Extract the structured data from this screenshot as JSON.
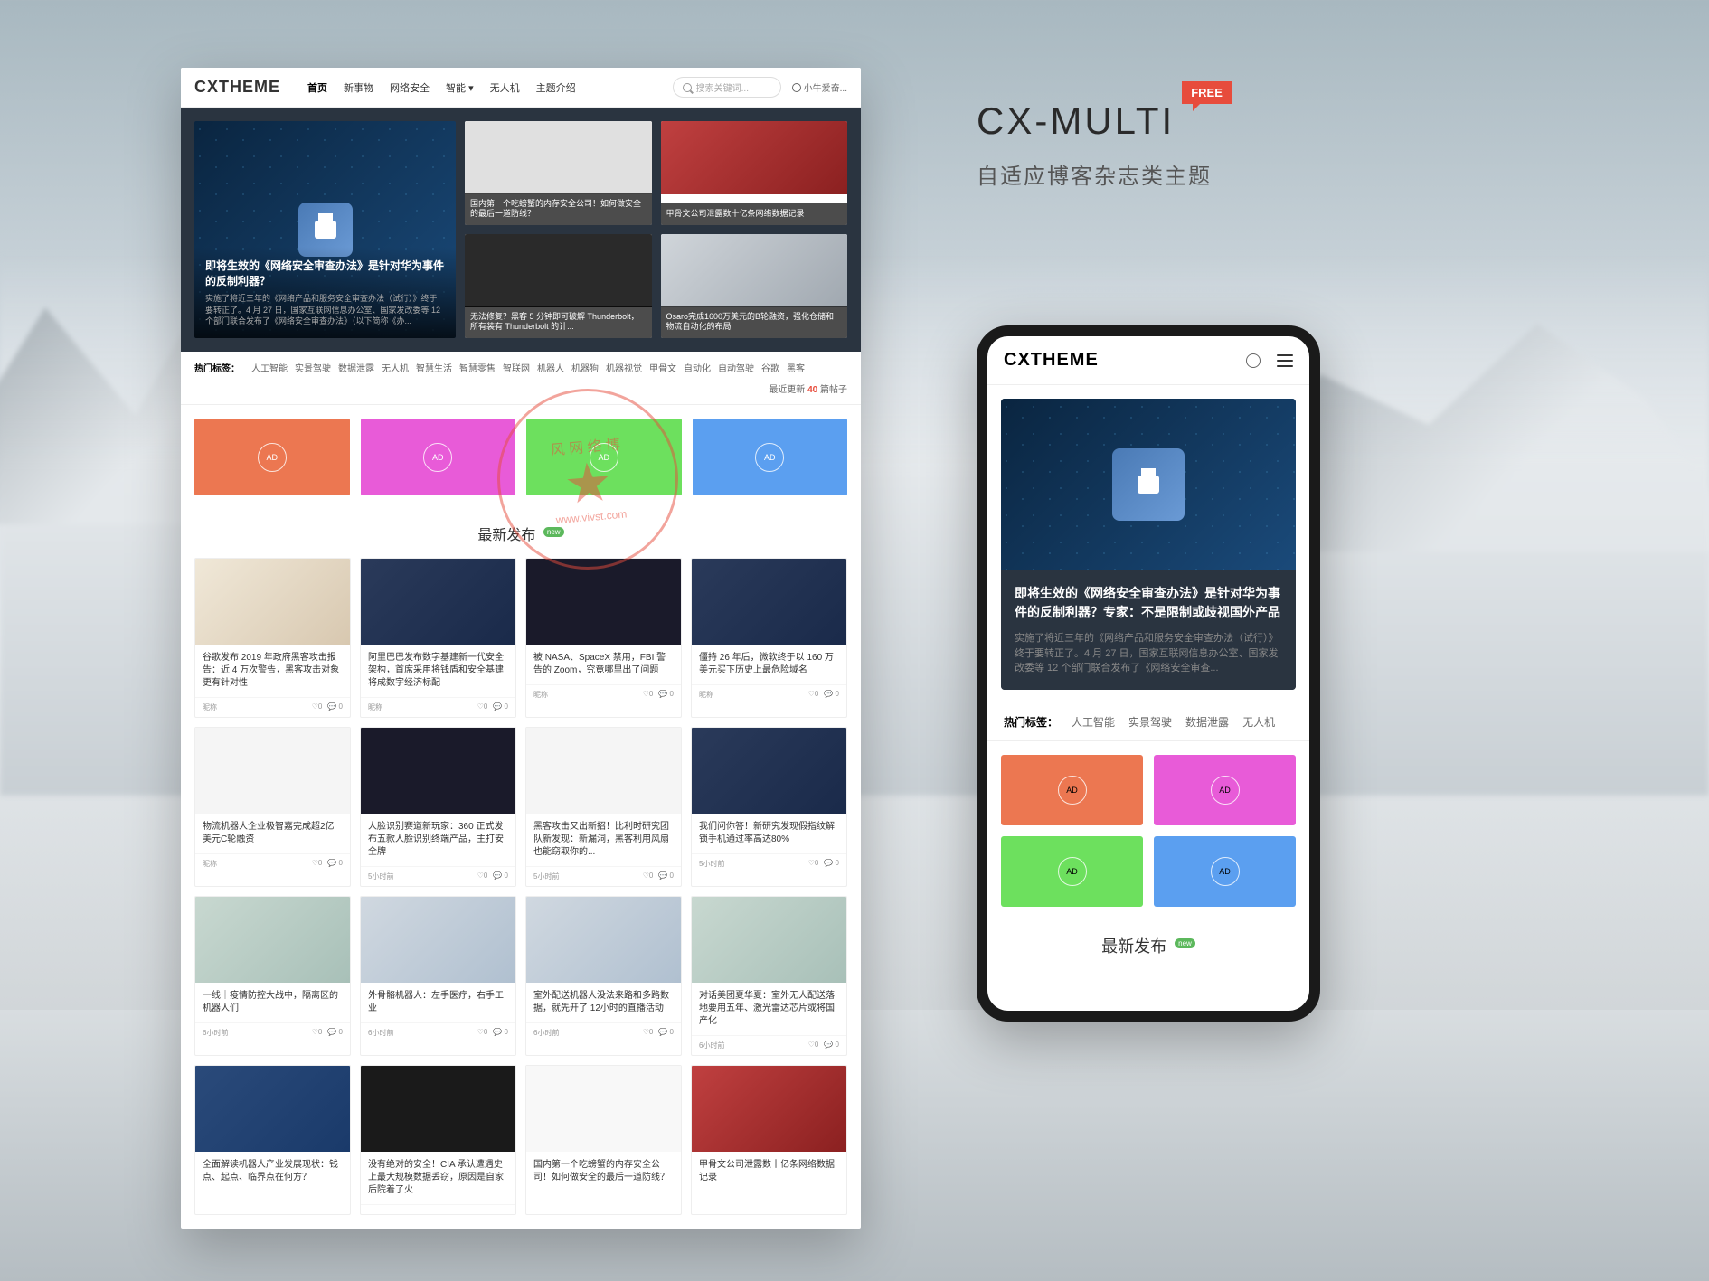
{
  "promo": {
    "title": "CX-MULTI",
    "badge": "FREE",
    "subtitle": "自适应博客杂志类主题"
  },
  "desktop": {
    "logo": "CXTHEME",
    "nav": [
      "首页",
      "新事物",
      "网络安全",
      "智能 ▾",
      "无人机",
      "主题介绍"
    ],
    "search_placeholder": "搜索关键词...",
    "user_label": "小牛爱奋...",
    "hero": {
      "main_title": "即将生效的《网络安全审查办法》是针对华为事件的反制利器？",
      "main_desc": "实施了将近三年的《网络产品和服务安全审查办法（试行）》终于要转正了。4 月 27 日，国家互联网信息办公室、国家发改委等 12 个部门联合发布了《网络安全审查办法》（以下简称《办...",
      "side1": "国内第一个吃螃蟹的内存安全公司！如何做安全的最后一道防线？",
      "side2": "甲骨文公司泄露数十亿条网络数据记录",
      "side3": "无法修复？黑客 5 分钟即可破解 Thunderbolt，所有装有 Thunderbolt 的计...",
      "side4": "Osaro完成1600万美元的B轮融资，强化仓储和物流自动化的布局"
    },
    "tags_label": "热门标签：",
    "tags": [
      "人工智能",
      "实景驾驶",
      "数据泄露",
      "无人机",
      "智慧生活",
      "智慧零售",
      "智联网",
      "机器人",
      "机器狗",
      "机器视觉",
      "甲骨文",
      "自动化",
      "自动驾驶",
      "谷歌",
      "黑客"
    ],
    "posts_count_prefix": "最近更新",
    "posts_count_num": "40",
    "posts_count_suffix": "篇帖子",
    "ad_label": "AD",
    "section_title": "最新发布",
    "new_label": "new",
    "posts": [
      {
        "title": "谷歌发布 2019 年政府黑客攻击报告：近 4 万次警告，黑客攻击对象更有针对性",
        "author": "昵称",
        "likes": "♡0",
        "comments": "💬 0"
      },
      {
        "title": "阿里巴巴发布数字基建新一代安全架构，首席采用将钱盾和安全基建将成数字经济标配",
        "author": "昵称",
        "likes": "♡0",
        "comments": "💬 0"
      },
      {
        "title": "被 NASA、SpaceX 禁用，FBI 警告的 Zoom，究竟哪里出了问题",
        "author": "昵称",
        "likes": "♡0",
        "comments": "💬 0"
      },
      {
        "title": "僵持 26 年后，微软终于以 160 万美元买下历史上最危险域名",
        "author": "昵称",
        "likes": "♡0",
        "comments": "💬 0"
      },
      {
        "title": "物流机器人企业极智嘉完成超2亿美元C轮融资",
        "author": "昵称",
        "likes": "♡0",
        "comments": "💬 0"
      },
      {
        "title": "人脸识别赛道新玩家：360 正式发布五款人脸识别终端产品，主打安全牌",
        "author": "5小时前",
        "likes": "♡0",
        "comments": "💬 0"
      },
      {
        "title": "黑客攻击又出新招！比利时研究团队新发现：新漏洞，黑客利用风扇也能窃取你的...",
        "author": "5小时前",
        "likes": "♡0",
        "comments": "💬 0"
      },
      {
        "title": "我们问你答！新研究发现假指纹解锁手机通过率高达80%",
        "author": "5小时前",
        "likes": "♡0",
        "comments": "💬 0"
      },
      {
        "title": "一线｜疫情防控大战中，隔离区的机器人们",
        "author": "6小时前",
        "likes": "♡0",
        "comments": "💬 0"
      },
      {
        "title": "外骨骼机器人：左手医疗，右手工业",
        "author": "6小时前",
        "likes": "♡0",
        "comments": "💬 0"
      },
      {
        "title": "室外配送机器人没法来路和多路数据，就先开了 12小时的直播活动",
        "author": "6小时前",
        "likes": "♡0",
        "comments": "💬 0"
      },
      {
        "title": "对话美团夏华夏：室外无人配送落地要用五年、激光雷达芯片或将国产化",
        "author": "6小时前",
        "likes": "♡0",
        "comments": "💬 0"
      },
      {
        "title": "全面解读机器人产业发展现状：钱点、起点、临界点在何方？",
        "author": "",
        "likes": "",
        "comments": ""
      },
      {
        "title": "没有绝对的安全！CIA 承认遭遇史上最大规模数据丢窃，原因是自家后院着了火",
        "author": "",
        "likes": "",
        "comments": ""
      },
      {
        "title": "国内第一个吃螃蟹的内存安全公司！如何做安全的最后一道防线？",
        "author": "",
        "likes": "",
        "comments": ""
      },
      {
        "title": "甲骨文公司泄露数十亿条网络数据记录",
        "author": "",
        "likes": "",
        "comments": ""
      }
    ]
  },
  "mobile": {
    "logo": "CXTHEME",
    "hero_title": "即将生效的《网络安全审查办法》是针对华为事件的反制利器？专家：不是限制或歧视国外产品",
    "hero_desc": "实施了将近三年的《网络产品和服务安全审查办法（试行）》终于要转正了。4 月 27 日，国家互联网信息办公室、国家发改委等 12 个部门联合发布了《网络安全审查...",
    "tags_label": "热门标签：",
    "tags": [
      "人工智能",
      "实景驾驶",
      "数据泄露",
      "无人机"
    ],
    "ad_label": "AD",
    "section_title": "最新发布",
    "new_label": "new"
  },
  "watermark": {
    "text_top": "风 网 络 博",
    "url": "www.vivst.com"
  }
}
